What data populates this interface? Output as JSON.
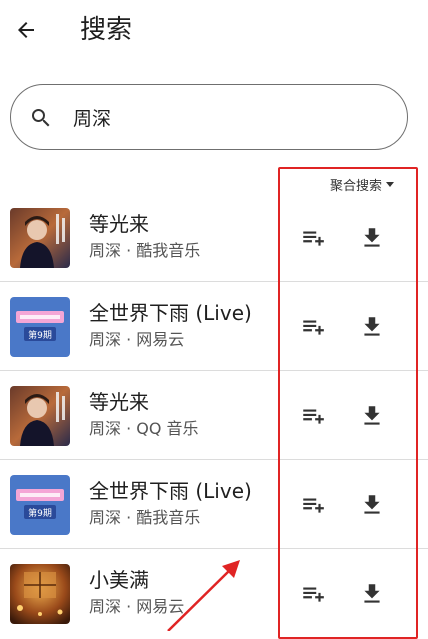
{
  "header": {
    "title": "搜索",
    "back_icon": "arrow-back-icon"
  },
  "search": {
    "value": "周深",
    "icon": "search-icon"
  },
  "sort": {
    "label": "聚合搜索"
  },
  "songs": [
    {
      "title": "等光来",
      "meta": "周深 · 酷我音乐",
      "cover": "portrait"
    },
    {
      "title": "全世界下雨 (Live)",
      "meta": "周深 · 网易云",
      "cover": "episode"
    },
    {
      "title": "等光来",
      "meta": "周深 · QQ 音乐",
      "cover": "portrait"
    },
    {
      "title": "全世界下雨 (Live)",
      "meta": "周深 · 酷我音乐",
      "cover": "episode"
    },
    {
      "title": "小美满",
      "meta": "周深 · 网易云",
      "cover": "warm"
    }
  ],
  "cover_art": {
    "episode_badge": "第9期"
  },
  "actions": {
    "queue_icon": "playlist-add-icon",
    "download_icon": "download-icon"
  },
  "colors": {
    "annotation": "#e02424",
    "episode_cover_bg": "#4a78c8"
  }
}
